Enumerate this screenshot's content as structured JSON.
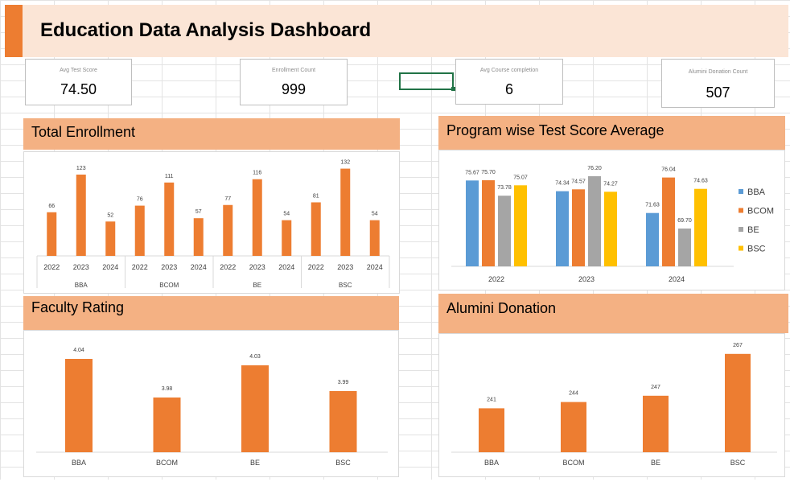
{
  "dashboard": {
    "title": "Education Data Analysis Dashboard"
  },
  "kpis": [
    {
      "label": "Avg Test Score",
      "value": "74.50"
    },
    {
      "label": "Enrollment Count",
      "value": "999"
    },
    {
      "label": "Avg Course completion",
      "value": "6"
    },
    {
      "label": "Alumini Donation Count",
      "value": "507"
    }
  ],
  "panels": {
    "enrollment": "Total Enrollment",
    "test_score": "Program wise Test Score Average",
    "faculty": "Faculty Rating",
    "donation": "Alumini Donation"
  },
  "colors": {
    "bar": "#ed7d31",
    "header": "#f4b183",
    "title_band": "#fbe5d6",
    "BBA": "#5b9bd5",
    "BCOM": "#ed7d31",
    "BE": "#a5a5a5",
    "BSC": "#ffc000"
  },
  "chart_data": [
    {
      "type": "bar",
      "title": "Total Enrollment",
      "groups": [
        "BBA",
        "BCOM",
        "BE",
        "BSC"
      ],
      "categories": [
        "2022",
        "2023",
        "2024"
      ],
      "values": [
        [
          66,
          123,
          52
        ],
        [
          76,
          111,
          57
        ],
        [
          77,
          116,
          54
        ],
        [
          81,
          132,
          54
        ]
      ]
    },
    {
      "type": "bar",
      "title": "Program wise Test Score Average",
      "categories": [
        "2022",
        "2023",
        "2024"
      ],
      "series": [
        {
          "name": "BBA",
          "values": [
            75.67,
            74.34,
            71.63
          ]
        },
        {
          "name": "BCOM",
          "values": [
            75.7,
            74.57,
            76.04
          ]
        },
        {
          "name": "BE",
          "values": [
            73.78,
            76.2,
            69.7
          ]
        },
        {
          "name": "BSC",
          "values": [
            75.07,
            74.27,
            74.63
          ]
        }
      ],
      "legend": "right"
    },
    {
      "type": "bar",
      "title": "Faculty Rating",
      "categories": [
        "BBA",
        "BCOM",
        "BE",
        "BSC"
      ],
      "values": [
        4.04,
        3.98,
        4.03,
        3.99
      ]
    },
    {
      "type": "bar",
      "title": "Alumini Donation",
      "categories": [
        "BBA",
        "BCOM",
        "BE",
        "BSC"
      ],
      "values": [
        241,
        244,
        247,
        267
      ]
    }
  ]
}
